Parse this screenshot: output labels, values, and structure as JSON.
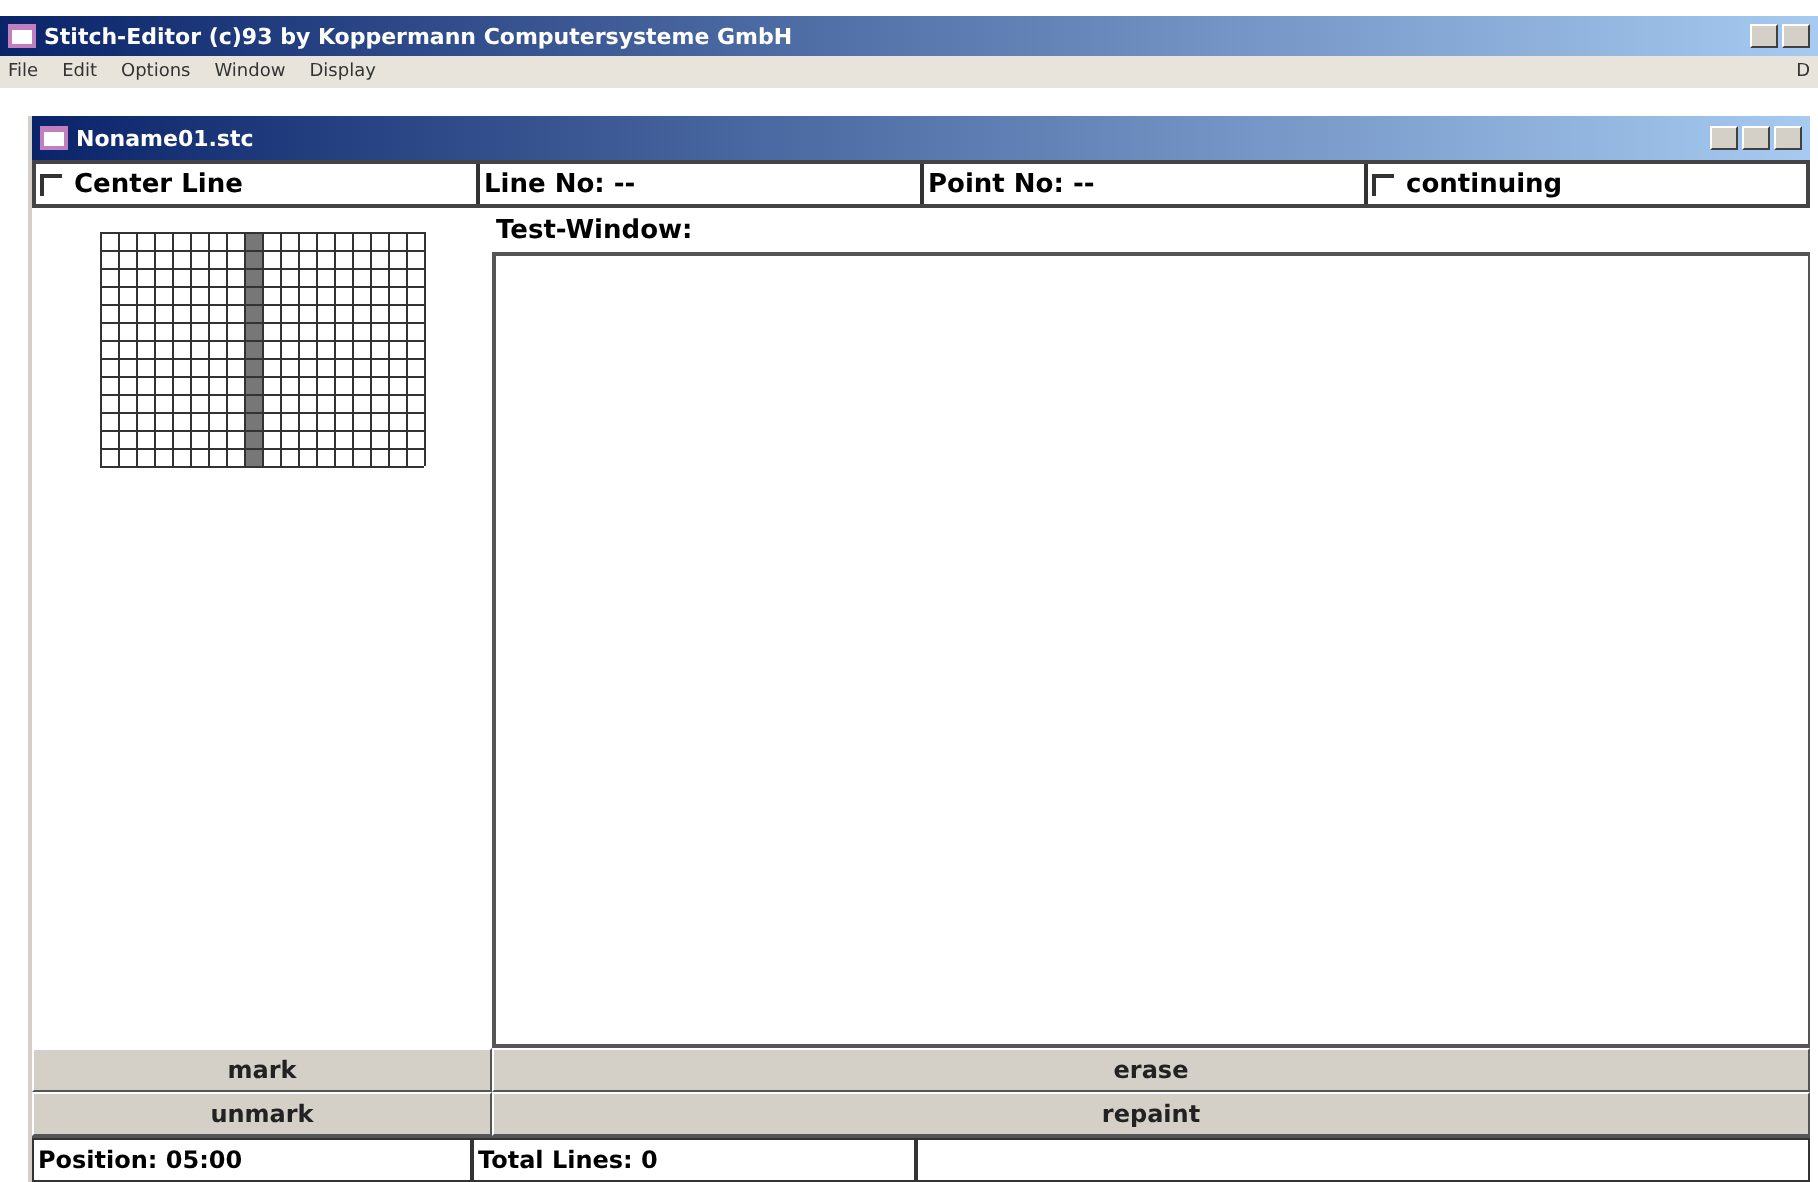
{
  "window": {
    "title": "Stitch-Editor (c)93 by Koppermann Computersysteme GmbH"
  },
  "menu": [
    "File",
    "Edit",
    "Options",
    "Window",
    "Display"
  ],
  "menu_right": "D",
  "document": {
    "title": "Noname01.stc"
  },
  "toolbar": {
    "center_line": {
      "label": "Center Line",
      "checked": false
    },
    "line_no": "Line No: --",
    "point_no": "Point No: --",
    "continuing": {
      "label": "continuing",
      "checked": false
    }
  },
  "test_window": {
    "label": "Test-Window:"
  },
  "buttons": [
    [
      "mark",
      "erase"
    ],
    [
      "unmark",
      "repaint"
    ]
  ],
  "status_bar": {
    "position": "Position: 05:00",
    "total_lines": "Total Lines:  0"
  }
}
